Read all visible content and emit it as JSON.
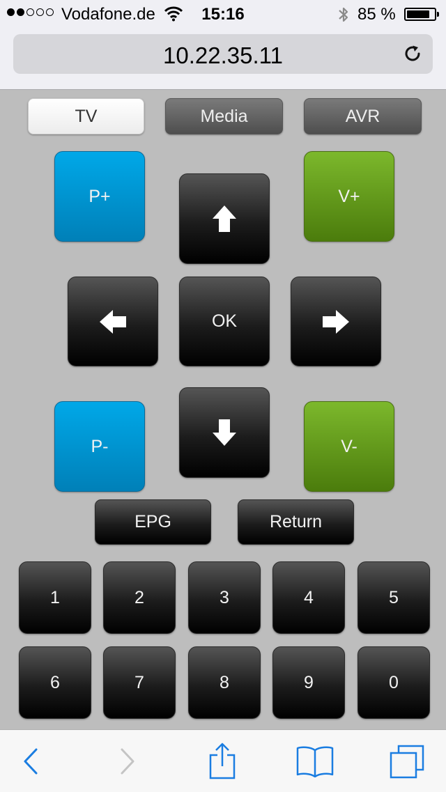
{
  "status_bar": {
    "signal": [
      true,
      true,
      false,
      false,
      false
    ],
    "carrier": "Vodafone.de",
    "time": "15:16",
    "battery_percent": "85 %",
    "battery_level": 0.85
  },
  "address_bar": {
    "url": "10.22.35.11"
  },
  "source_tabs": {
    "tv": "TV",
    "media": "Media",
    "avr": "AVR",
    "active": "TV"
  },
  "remote": {
    "program_up": "P+",
    "program_down": "P-",
    "volume_up": "V+",
    "volume_down": "V-",
    "ok": "OK",
    "epg": "EPG",
    "return": "Return",
    "digits": [
      "1",
      "2",
      "3",
      "4",
      "5",
      "6",
      "7",
      "8",
      "9",
      "0"
    ]
  },
  "colors": {
    "program_blue": "#00a0e0",
    "volume_green": "#6aa424",
    "button_dark": "#1c1c1c",
    "ios_blue": "#1a7de1",
    "panel_gray": "#bdbdbd"
  },
  "toolbar": {
    "icons": [
      "back-icon",
      "forward-icon",
      "share-icon",
      "bookmarks-icon",
      "tabs-icon"
    ]
  }
}
